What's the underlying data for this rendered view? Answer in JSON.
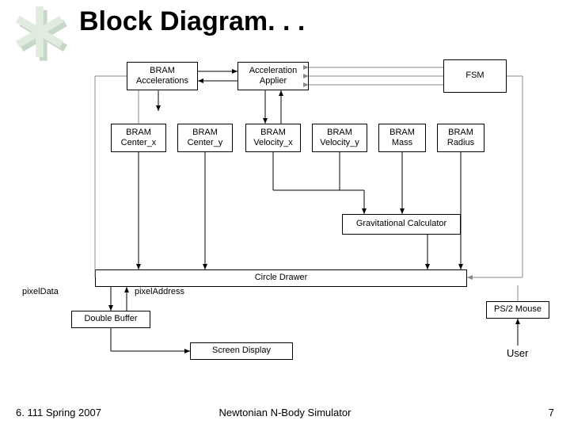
{
  "title": "Block Diagram. . .",
  "blocks": {
    "bram_accel": {
      "l1": "BRAM",
      "l2": "Accelerations"
    },
    "accel_applier": {
      "l1": "Acceleration",
      "l2": "Applier"
    },
    "fsm": {
      "l1": "FSM"
    },
    "bram_cx": {
      "l1": "BRAM",
      "l2": "Center_x"
    },
    "bram_cy": {
      "l1": "BRAM",
      "l2": "Center_y"
    },
    "bram_vx": {
      "l1": "BRAM",
      "l2": "Velocity_x"
    },
    "bram_vy": {
      "l1": "BRAM",
      "l2": "Velocity_y"
    },
    "bram_mass": {
      "l1": "BRAM",
      "l2": "Mass"
    },
    "bram_radius": {
      "l1": "BRAM",
      "l2": "Radius"
    },
    "grav_calc": {
      "l1": "Gravitational Calculator"
    },
    "circle_drawer": {
      "l1": "Circle Drawer"
    },
    "double_buffer": {
      "l1": "Double Buffer"
    },
    "screen_display": {
      "l1": "Screen Display"
    },
    "ps2_mouse": {
      "l1": "PS/2 Mouse"
    }
  },
  "labels": {
    "pixel_data": "pixelData",
    "pixel_address": "pixelAddress",
    "user": "User"
  },
  "footer": {
    "left": "6. 111 Spring 2007",
    "center": "Newtonian N-Body Simulator",
    "right": "7"
  }
}
